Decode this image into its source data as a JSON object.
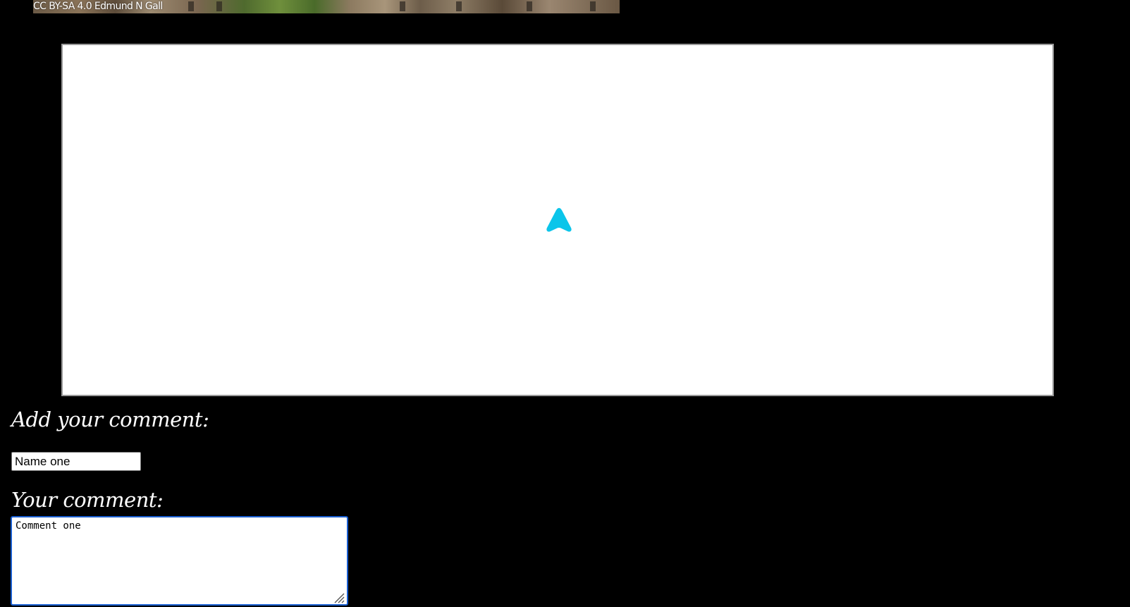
{
  "photo": {
    "credit": "CC BY-SA 4.0 Edmund N Gall"
  },
  "embed": {
    "icon": "navigation-arrow-icon",
    "icon_color": "#0bc5ea"
  },
  "comment_form": {
    "add_heading": "Add your comment:",
    "name_value": "Name one",
    "comment_heading": "Your comment:",
    "comment_value": "Comment one",
    "focus_color": "#1a5fd1"
  }
}
